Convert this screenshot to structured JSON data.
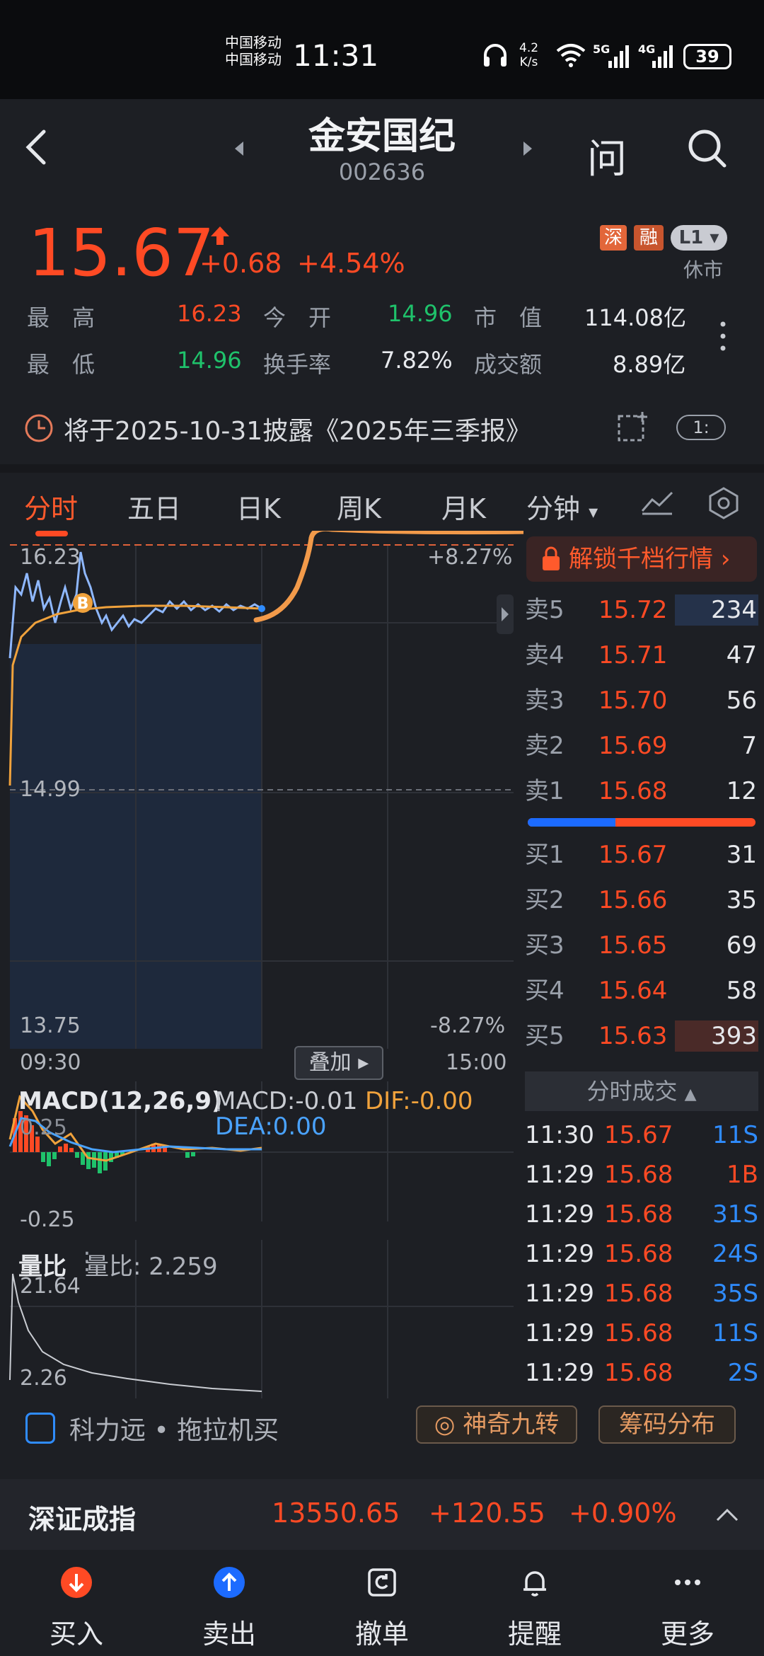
{
  "status_bar": {
    "carrier_1": "中国移动",
    "carrier_2": "中国移动",
    "time": "11:31",
    "net_speed_value": "4.2",
    "net_speed_unit": "K/s",
    "signal_1": "5G",
    "signal_2": "4G",
    "battery": "39"
  },
  "header": {
    "stock_name": "金安国纪",
    "stock_code": "002636",
    "ask_label": "问"
  },
  "quote": {
    "price": "15.67",
    "change": "+0.68",
    "change_pct": "+4.54%",
    "tag_shen": "深",
    "tag_rong": "融",
    "tag_level": "L1",
    "market_status": "休市",
    "stats": {
      "high_label": "最　高",
      "high_value": "16.23",
      "open_label": "今　开",
      "open_value": "14.96",
      "mcap_label": "市　值",
      "mcap_value": "114.08亿",
      "low_label": "最　低",
      "low_value": "14.96",
      "turnover_label": "换手率",
      "turnover_value": "7.82%",
      "amount_label": "成交额",
      "amount_value": "8.89亿"
    }
  },
  "disclosure": {
    "text": "将于2025-10-31披露《2025年三季报》",
    "toggle": "1:"
  },
  "tabs": [
    "分时",
    "五日",
    "日K",
    "周K",
    "月K",
    "分钟"
  ],
  "active_tab": "分时",
  "intraday": {
    "y_top": "16.23",
    "y_mid": "14.99",
    "y_bottom": "13.75",
    "pct_top": "+8.27%",
    "pct_bottom": "-8.27%",
    "time_start": "09:30",
    "time_end": "15:00",
    "overlay_label": "叠加",
    "marker_b": "B"
  },
  "macd": {
    "title": "MACD(12,26,9)",
    "macd_value": "MACD:-0.01",
    "dif_value": "DIF:-0.00",
    "dea_value": "DEA:0.00",
    "y_top": "0.25",
    "y_bottom": "-0.25"
  },
  "volume_ratio": {
    "title": "量比",
    "value_label": "量比:  2.259",
    "y_top": "21.64",
    "y_bottom": "2.26"
  },
  "order_book": {
    "unlock_label": "解锁千档行情",
    "asks": [
      {
        "label": "卖5",
        "price": "15.72",
        "vol": "234"
      },
      {
        "label": "卖4",
        "price": "15.71",
        "vol": "47"
      },
      {
        "label": "卖3",
        "price": "15.70",
        "vol": "56"
      },
      {
        "label": "卖2",
        "price": "15.69",
        "vol": "7"
      },
      {
        "label": "卖1",
        "price": "15.68",
        "vol": "12"
      }
    ],
    "bids": [
      {
        "label": "买1",
        "price": "15.67",
        "vol": "31"
      },
      {
        "label": "买2",
        "price": "15.66",
        "vol": "35"
      },
      {
        "label": "买3",
        "price": "15.65",
        "vol": "69"
      },
      {
        "label": "买4",
        "price": "15.64",
        "vol": "58"
      },
      {
        "label": "买5",
        "price": "15.63",
        "vol": "393"
      }
    ]
  },
  "ticks": {
    "header": "分时成交",
    "rows": [
      {
        "time": "11:30",
        "price": "15.67",
        "vol": "11S",
        "side": "S"
      },
      {
        "time": "11:29",
        "price": "15.68",
        "vol": "1B",
        "side": "B"
      },
      {
        "time": "11:29",
        "price": "15.68",
        "vol": "31S",
        "side": "S"
      },
      {
        "time": "11:29",
        "price": "15.68",
        "vol": "24S",
        "side": "S"
      },
      {
        "time": "11:29",
        "price": "15.68",
        "vol": "35S",
        "side": "S"
      },
      {
        "time": "11:29",
        "price": "15.68",
        "vol": "11S",
        "side": "S"
      },
      {
        "time": "11:29",
        "price": "15.68",
        "vol": "2S",
        "side": "S"
      }
    ]
  },
  "indicators": {
    "klf_name": "科力远",
    "klf_sep": "•",
    "klf_note": "拖拉机买",
    "magic_nine": "神奇九转",
    "chip_dist": "筹码分布"
  },
  "index": {
    "name": "深证成指",
    "value": "13550.65",
    "change": "+120.55",
    "pct": "+0.90%"
  },
  "nav": [
    {
      "label": "买入",
      "icon": "buy-icon"
    },
    {
      "label": "卖出",
      "icon": "sell-icon"
    },
    {
      "label": "撤单",
      "icon": "cancel-order-icon"
    },
    {
      "label": "提醒",
      "icon": "bell-icon"
    },
    {
      "label": "更多",
      "icon": "more-icon"
    }
  ],
  "colors": {
    "up": "#ff4a24",
    "down": "#1fc26b",
    "accent_blue": "#2f8cff",
    "background": "#1d1f24"
  }
}
